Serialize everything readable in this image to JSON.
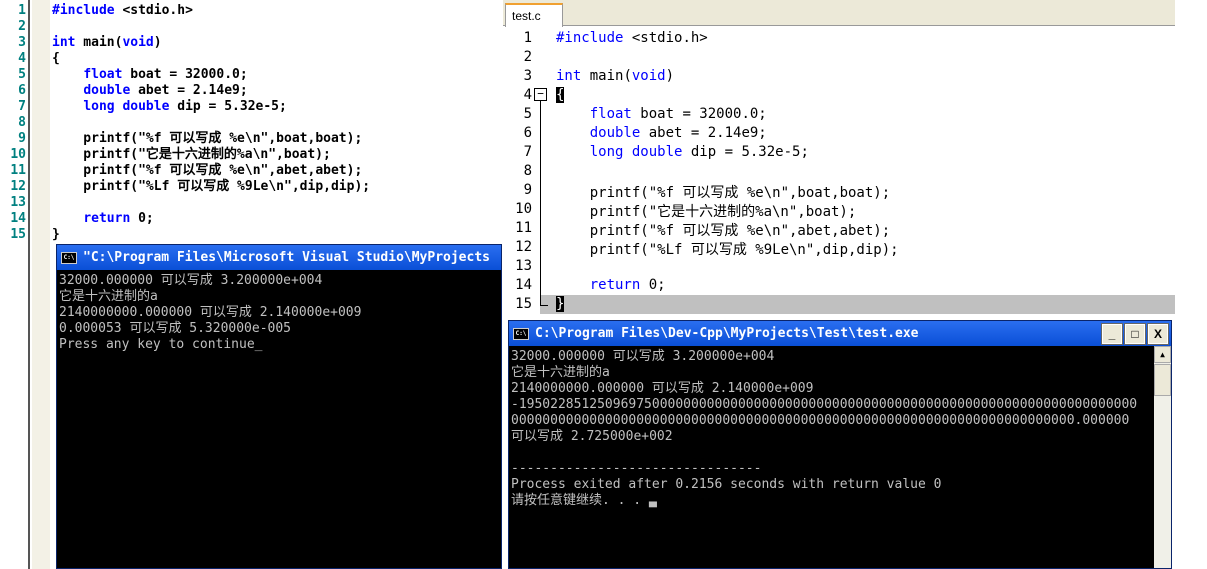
{
  "left_editor": {
    "lines": [
      "#include <stdio.h>",
      "",
      "int main(void)",
      "{",
      "    float boat = 32000.0;",
      "    double abet = 2.14e9;",
      "    long double dip = 5.32e-5;",
      "",
      "    printf(\"%f 可以写成 %e\\n\",boat,boat);",
      "    printf(\"它是十六进制的%a\\n\",boat);",
      "    printf(\"%f 可以写成 %e\\n\",abet,abet);",
      "    printf(\"%Lf 可以写成 %9Le\\n\",dip,dip);",
      "",
      "    return 0;",
      "}"
    ]
  },
  "left_console": {
    "title": "\"C:\\Program Files\\Microsoft Visual Studio\\MyProjects",
    "icon": "C:\\",
    "output": "32000.000000 可以写成 3.200000e+004\n它是十六进制的a\n2140000000.000000 可以写成 2.140000e+009\n0.000053 可以写成 5.320000e-005\nPress any key to continue_"
  },
  "right_editor": {
    "tab": "test.c",
    "lines": [
      "#include <stdio.h>",
      "",
      "int main(void)",
      "{",
      "    float boat = 32000.0;",
      "    double abet = 2.14e9;",
      "    long double dip = 5.32e-5;",
      "",
      "    printf(\"%f 可以写成 %e\\n\",boat,boat);",
      "    printf(\"它是十六进制的%a\\n\",boat);",
      "    printf(\"%f 可以写成 %e\\n\",abet,abet);",
      "    printf(\"%Lf 可以写成 %9Le\\n\",dip,dip);",
      "",
      "    return 0;",
      "}"
    ]
  },
  "right_console": {
    "title": "C:\\Program Files\\Dev-Cpp\\MyProjects\\Test\\test.exe",
    "icon": "C:\\",
    "buttons": {
      "minimize": "_",
      "maximize": "□",
      "close": "X"
    },
    "output": "32000.000000 可以写成 3.200000e+004\n它是十六进制的a\n2140000000.000000 可以写成 2.140000e+009\n-1950228512509697500000000000000000000000000000000000000000000000000000000000000\n000000000000000000000000000000000000000000000000000000000000000000000000.000000\n可以写成 2.725000e+002\n\n--------------------------------\nProcess exited after 0.2156 seconds with return value 0\n请按任意键继续. . . ▃"
  },
  "colors": {
    "keyword": "#0000ff",
    "line_number_left": "#008080",
    "title_bar": "#0a4fd6",
    "console_bg": "#000000",
    "console_text": "#c0c0c0",
    "current_line": "#c0c0c0"
  }
}
